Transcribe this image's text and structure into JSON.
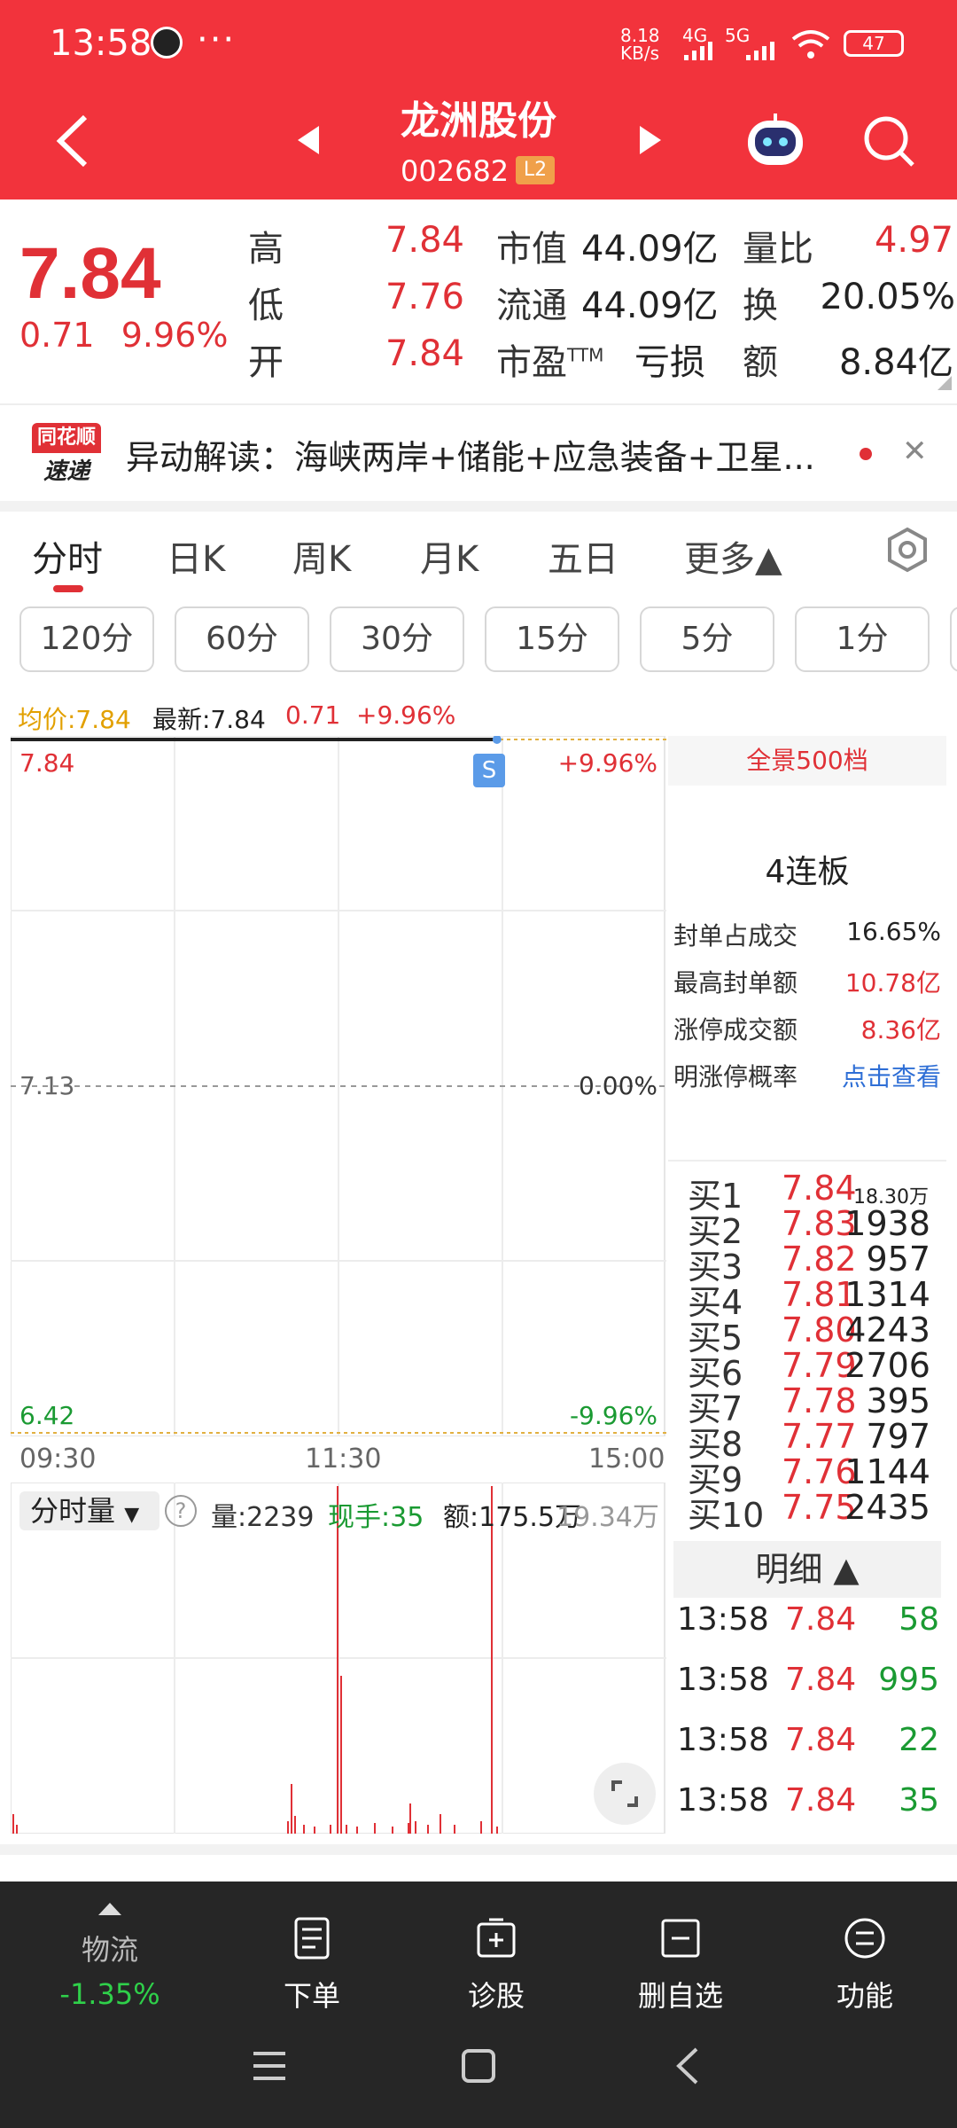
{
  "status_bar": {
    "time": "13:58",
    "dots": "···",
    "net_speed_top": "8.18",
    "net_speed_unit": "KB/s",
    "net_4g": "4G",
    "net_5g": "5G",
    "battery": "47"
  },
  "header": {
    "stock_name": "龙洲股份",
    "stock_code": "002682",
    "level_badge": "L2"
  },
  "quote": {
    "price": "7.84",
    "change": "0.71",
    "change_pct": "9.96%",
    "high_label": "高",
    "high": "7.84",
    "low_label": "低",
    "low": "7.76",
    "open_label": "开",
    "open": "7.84",
    "mcap_label": "市值",
    "mcap": "44.09亿",
    "float_label": "流通",
    "float": "44.09亿",
    "pe_label": "市盈",
    "pe_sup": "TTM",
    "pe": "亏损",
    "vr_label": "量比",
    "vr": "4.97",
    "turnover_label": "换",
    "turnover": "20.05%",
    "amount_label": "额",
    "amount": "8.84亿"
  },
  "news": {
    "logo_top": "同花顺",
    "logo_bottom": "速递",
    "text": "异动解读：海峡两岸+储能+应急装备+卫星...",
    "close": "✕"
  },
  "tabs": [
    "分时",
    "日K",
    "周K",
    "月K",
    "五日",
    "更多▲"
  ],
  "periods": [
    "120分",
    "60分",
    "30分",
    "15分",
    "5分",
    "1分"
  ],
  "chart_info": {
    "avg_label": "均价:7.84",
    "latest_label": "最新:7.84",
    "change": "0.71",
    "change_pct": "+9.96%"
  },
  "chart_data": {
    "type": "line",
    "title": "",
    "y_left_ticks": [
      "7.84",
      "7.13",
      "6.42"
    ],
    "y_right_ticks": [
      "+9.96%",
      "0.00%",
      "-9.96%"
    ],
    "x_ticks": [
      "09:30",
      "11:30",
      "15:00"
    ],
    "ylim": [
      6.42,
      7.84
    ],
    "series": [
      {
        "x": [
          "09:30",
          "13:58"
        ],
        "values": [
          7.84,
          7.84
        ]
      }
    ],
    "marker": "S",
    "volume_max_label": "19.34万"
  },
  "volume_panel": {
    "selector": "分时量",
    "help": "?",
    "vol": "量:2239",
    "current_hand": "现手:35",
    "amount": "额:175.5万"
  },
  "side_panel": {
    "title": "全景500档",
    "big": "4连板",
    "rows": [
      {
        "label": "封单占成交",
        "value": "16.65%",
        "color": "dark"
      },
      {
        "label": "最高封单额",
        "value": "10.78亿",
        "color": "red"
      },
      {
        "label": "涨停成交额",
        "value": "8.36亿",
        "color": "red"
      },
      {
        "label": "明涨停概率",
        "value": "点击查看",
        "color": "blue"
      }
    ],
    "orderbook": [
      {
        "label": "买1",
        "price": "7.84",
        "vol": "18.30万"
      },
      {
        "label": "买2",
        "price": "7.83",
        "vol": "1938"
      },
      {
        "label": "买3",
        "price": "7.82",
        "vol": "957"
      },
      {
        "label": "买4",
        "price": "7.81",
        "vol": "1314"
      },
      {
        "label": "买5",
        "price": "7.80",
        "vol": "4243"
      },
      {
        "label": "买6",
        "price": "7.79",
        "vol": "2706"
      },
      {
        "label": "买7",
        "price": "7.78",
        "vol": "395"
      },
      {
        "label": "买8",
        "price": "7.77",
        "vol": "797"
      },
      {
        "label": "买9",
        "price": "7.76",
        "vol": "1144"
      },
      {
        "label": "买10",
        "price": "7.75",
        "vol": "2435"
      }
    ],
    "detail_head": "明细 ▲",
    "details": [
      {
        "time": "13:58",
        "price": "7.84",
        "vol": "58"
      },
      {
        "time": "13:58",
        "price": "7.84",
        "vol": "995"
      },
      {
        "time": "13:58",
        "price": "7.84",
        "vol": "22"
      },
      {
        "time": "13:58",
        "price": "7.84",
        "vol": "35"
      }
    ]
  },
  "bottom_bar": {
    "logistics_label": "物流",
    "logistics_pct": "-1.35%",
    "order": "下单",
    "diagnose": "诊股",
    "remove_fav": "删自选",
    "functions": "功能"
  },
  "colors": {
    "header": "#f2333c",
    "up": "#e03036",
    "down": "#1a9a32",
    "blue": "#2f6fd6"
  }
}
